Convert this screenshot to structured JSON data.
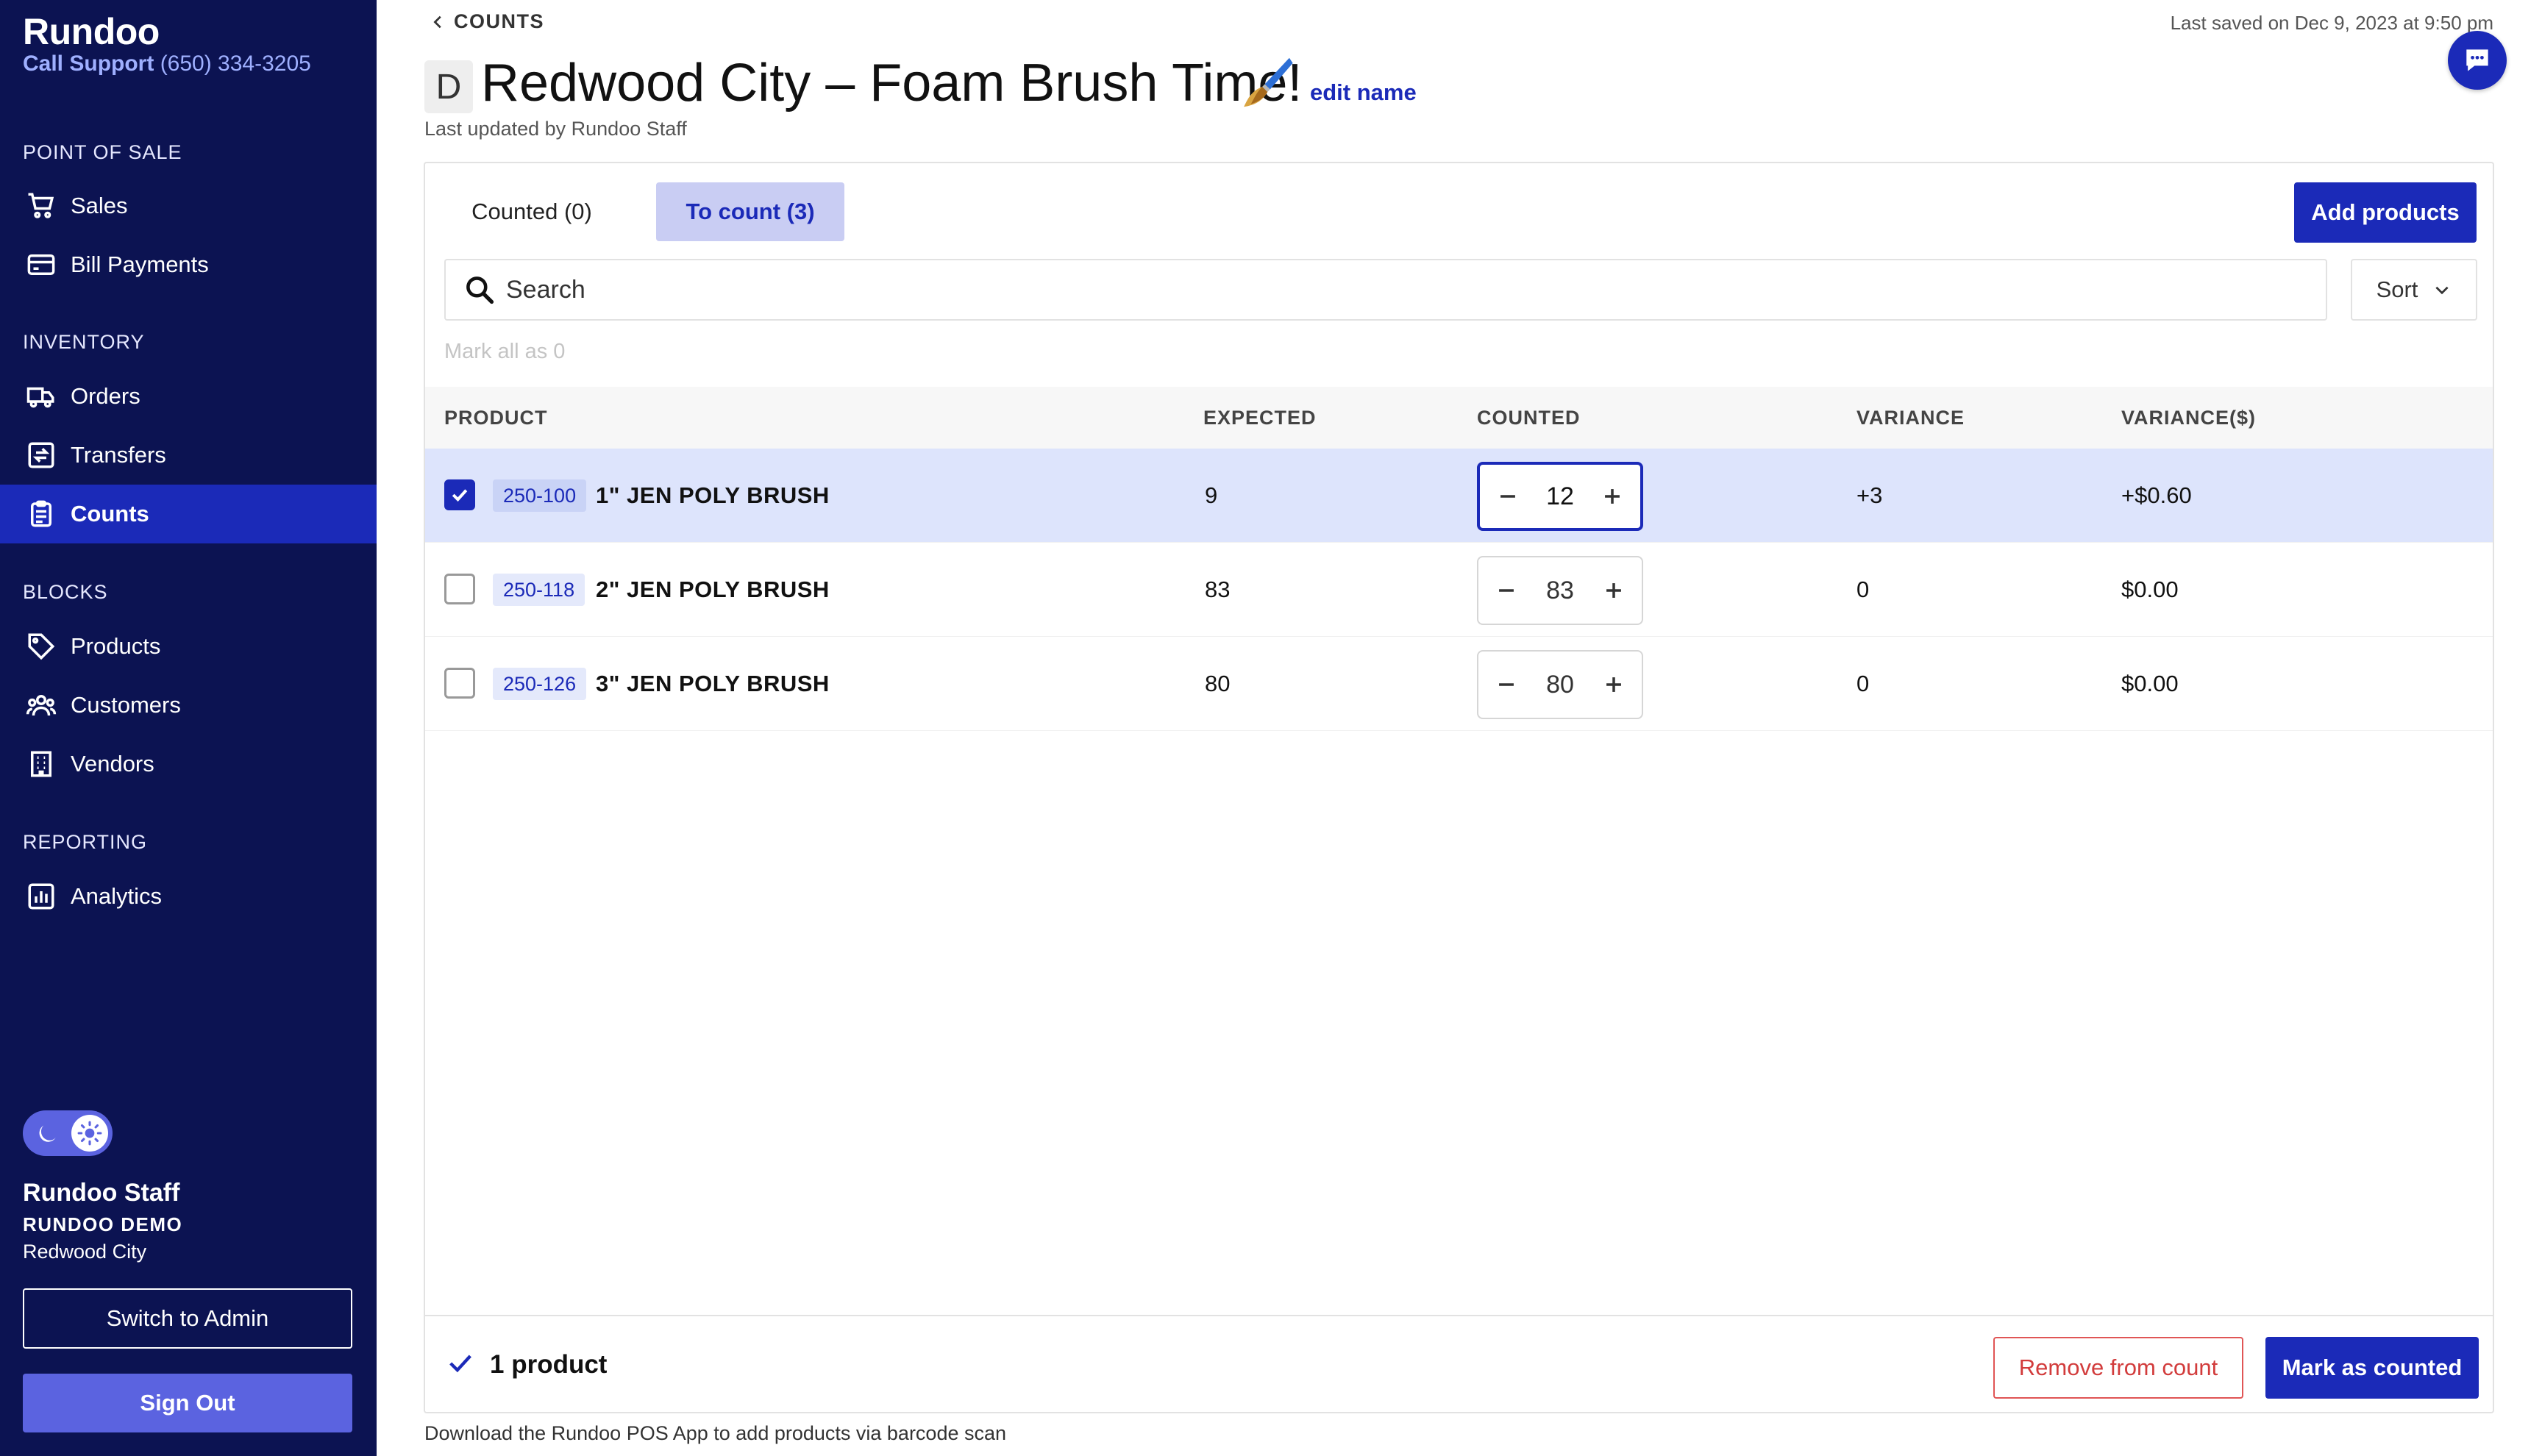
{
  "sidebar": {
    "brand": "Rundoo",
    "support_label": "Call Support",
    "support_phone": "(650) 334-3205",
    "sections": {
      "pos": "POINT OF SALE",
      "inventory": "INVENTORY",
      "blocks": "BLOCKS",
      "reporting": "REPORTING"
    },
    "items": {
      "sales": "Sales",
      "bill_payments": "Bill Payments",
      "orders": "Orders",
      "transfers": "Transfers",
      "counts": "Counts",
      "products": "Products",
      "customers": "Customers",
      "vendors": "Vendors",
      "analytics": "Analytics"
    },
    "active_item": "counts",
    "user": {
      "name": "Rundoo Staff",
      "org": "RUNDOO DEMO",
      "location": "Redwood City"
    },
    "switch_admin_label": "Switch to Admin",
    "sign_out_label": "Sign Out"
  },
  "header": {
    "breadcrumb": "COUNTS",
    "last_saved": "Last saved on Dec 9, 2023 at 9:50 pm",
    "avatar_letter": "D",
    "title": "Redwood City – Foam Brush Time!",
    "edit_name_label": "edit name",
    "updated_by": "Last updated by Rundoo Staff"
  },
  "tabs": {
    "counted": "Counted (0)",
    "to_count": "To count (3)",
    "active": "to_count"
  },
  "actions": {
    "add_products": "Add products",
    "sort": "Sort",
    "mark_all": "Mark all as 0"
  },
  "search": {
    "placeholder": "Search",
    "value": ""
  },
  "table": {
    "headers": {
      "product": "PRODUCT",
      "expected": "EXPECTED",
      "counted": "COUNTED",
      "variance": "VARIANCE",
      "variance_dollars": "VARIANCE($)"
    },
    "rows": [
      {
        "checked": true,
        "sku": "250-100",
        "name": "1\" JEN POLY BRUSH",
        "expected": "9",
        "counted": "12",
        "variance": "+3",
        "variance_dollars": "+$0.60"
      },
      {
        "checked": false,
        "sku": "250-118",
        "name": "2\" JEN POLY BRUSH",
        "expected": "83",
        "counted": "83",
        "variance": "0",
        "variance_dollars": "$0.00"
      },
      {
        "checked": false,
        "sku": "250-126",
        "name": "3\" JEN POLY BRUSH",
        "expected": "80",
        "counted": "80",
        "variance": "0",
        "variance_dollars": "$0.00"
      }
    ]
  },
  "footer": {
    "selected_count": "1 product",
    "remove_label": "Remove from count",
    "mark_counted_label": "Mark as counted",
    "note": "Download the Rundoo POS App to add products via barcode scan"
  },
  "colors": {
    "sidebar_bg": "#0c1352",
    "primary": "#1b2ab8",
    "selected_row": "#dde4fc",
    "danger": "#d23c3c"
  },
  "icons": {
    "breadcrumb": "chevron-left-icon",
    "chat": "chat-bubble-icon",
    "title_emoji": "paintbrush-icon",
    "search": "search-icon",
    "sort": "chevron-down-icon",
    "footer": "check-icon"
  }
}
